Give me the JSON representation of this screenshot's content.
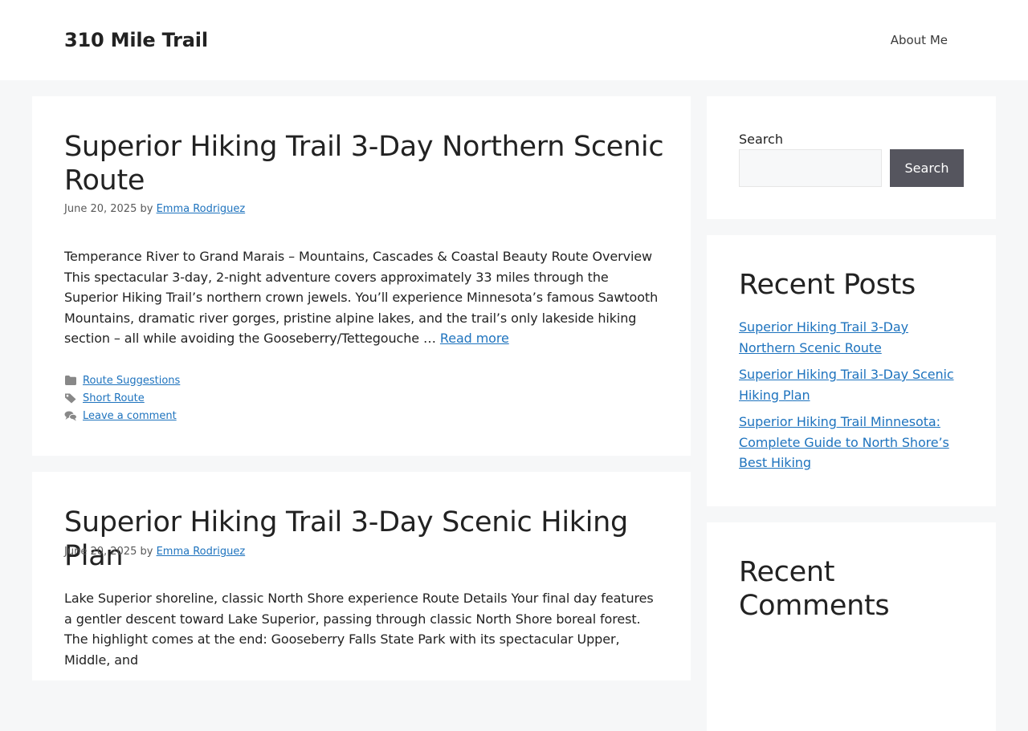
{
  "header": {
    "site_title": "310 Mile Trail",
    "nav": [
      {
        "label": "About Me"
      }
    ]
  },
  "posts": [
    {
      "title": "Superior Hiking Trail 3-Day Northern Scenic Route",
      "date": "June 20, 2025",
      "by": "by",
      "author": "Emma Rodriguez",
      "excerpt": "Temperance River to Grand Marais – Mountains, Cascades & Coastal Beauty Route Overview This spectacular 3-day, 2-night adventure covers approximately 33 miles through the Superior Hiking Trail’s northern crown jewels. You’ll experience Minnesota’s famous Sawtooth Mountains, dramatic river gorges, pristine alpine lakes, and the trail’s only lakeside hiking section – all while avoiding the Gooseberry/Tettegouche …",
      "read_more": "Read more",
      "category": "Route Suggestions",
      "tag": "Short Route",
      "comment_link": "Leave a comment"
    },
    {
      "title": "Superior Hiking Trail 3-Day Scenic Hiking Plan",
      "date": "June 20, 2025",
      "by": "by",
      "author": "Emma Rodriguez",
      "excerpt": "Lake Superior shoreline, classic North Shore experience Route Details Your final day features a gentler descent toward Lake Superior, passing through classic North Shore boreal forest. The highlight comes at the end: Gooseberry Falls State Park with its spectacular Upper, Middle, and"
    }
  ],
  "sidebar": {
    "search": {
      "label": "Search",
      "placeholder": "",
      "button": "Search"
    },
    "recent_posts": {
      "title": "Recent Posts",
      "items": [
        "Superior Hiking Trail 3-Day Northern Scenic Route",
        "Superior Hiking Trail 3-Day Scenic Hiking Plan",
        "Superior Hiking Trail Minnesota: Complete Guide to North Shore’s Best Hiking"
      ]
    },
    "recent_comments": {
      "title": "Recent Comments"
    }
  },
  "colors": {
    "link": "#1e73be",
    "background": "#f6f7f8",
    "button": "#55555e"
  }
}
